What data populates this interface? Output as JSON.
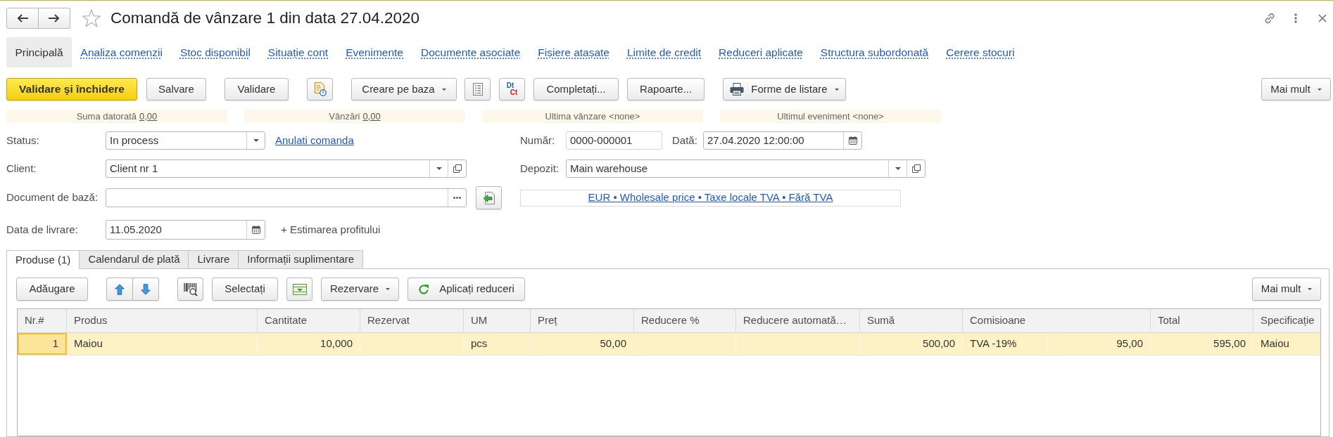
{
  "window": {
    "title": "Comandă de vânzare 1 din data 27.04.2020",
    "favorite": false
  },
  "sections": [
    {
      "label": "Principală",
      "selected": true
    },
    {
      "label": "Analiza comenzii",
      "selected": false
    },
    {
      "label": "Stoc disponibil",
      "selected": false
    },
    {
      "label": "Situație cont",
      "selected": false
    },
    {
      "label": "Evenimente",
      "selected": false
    },
    {
      "label": "Documente asociate",
      "selected": false
    },
    {
      "label": "Fișiere atașate",
      "selected": false
    },
    {
      "label": "Limite de credit",
      "selected": false
    },
    {
      "label": "Reduceri aplicate",
      "selected": false
    },
    {
      "label": "Structura subordonată",
      "selected": false
    },
    {
      "label": "Cerere stocuri",
      "selected": false
    }
  ],
  "toolbar": {
    "post_and_close": "Validare şi închidere",
    "save": "Salvare",
    "post": "Validare",
    "create_based_on": "Creare pe baza",
    "ledger": {
      "debit": "Dt",
      "credit": "Ct"
    },
    "fill": "Completați...",
    "reports": "Rapoarte...",
    "print_forms": "Forme de listare",
    "more": "Mai mult"
  },
  "summary": [
    {
      "label": "Suma datorată",
      "value": "0,00",
      "kind": "link"
    },
    {
      "label": "Vânzări",
      "value": "0,00",
      "kind": "link"
    },
    {
      "label": "Ultima vânzare",
      "value": "<none>",
      "kind": "plain"
    },
    {
      "label": "Ultimul eveniment",
      "value": "<none>",
      "kind": "plain"
    }
  ],
  "form": {
    "status": {
      "label": "Status:",
      "value": "In process"
    },
    "cancel_link": "Anulati comanda",
    "number": {
      "label": "Număr:",
      "value": "0000-000001"
    },
    "date": {
      "label": "Dată:",
      "value": "27.04.2020 12:00:00"
    },
    "client": {
      "label": "Client:",
      "value": "Client nr 1"
    },
    "warehouse": {
      "label": "Depozit:",
      "value": "Main warehouse"
    },
    "base_document": {
      "label": "Document de bază:"
    },
    "price_settings": "EUR • Wholesale price • Taxe locale TVA • Fără TVA",
    "delivery_date": {
      "label": "Data de livrare:",
      "value": "11.05.2020"
    },
    "profit_estimate": "+ Estimarea profitului"
  },
  "tabs": [
    {
      "label": "Produse (1)",
      "selected": true
    },
    {
      "label": "Calendarul de plată",
      "selected": false
    },
    {
      "label": "Livrare",
      "selected": false
    },
    {
      "label": "Informații suplimentare",
      "selected": false
    }
  ],
  "products_toolbar": {
    "add": "Adăugare",
    "select": "Selectați",
    "reserve": "Rezervare",
    "apply_discounts": "Aplicați reduceri",
    "more": "Mai mult"
  },
  "table": {
    "columns": [
      "Nr.#",
      "Produs",
      "Cantitate",
      "Rezervat",
      "UM",
      "Preț",
      "Reducere %",
      "Reducere automată…",
      "Sumă",
      "Comisioane",
      "Total",
      "Specificație"
    ],
    "rows": [
      {
        "selected": true,
        "number": "1",
        "product": "Maiou",
        "quantity": "10,000",
        "unit": "pcs",
        "price": "50,00",
        "amount": "500,00",
        "tax_rate": "TVA -19%",
        "tax_amount": "95,00",
        "total": "595,00",
        "specification": "Maiou"
      }
    ]
  }
}
